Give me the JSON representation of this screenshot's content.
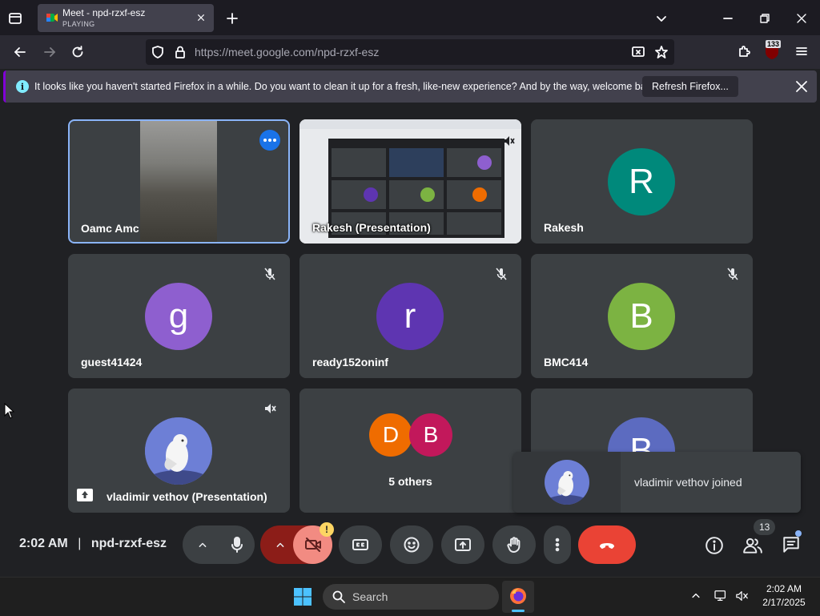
{
  "browser": {
    "tab_title": "Meet - npd-rzxf-esz",
    "tab_status": "PLAYING",
    "url_prefix": "https://meet.google.com/",
    "url_path": "npd-rzxf-esz",
    "extension_badge": "133"
  },
  "notification": {
    "message": "It looks like you haven't started Firefox in a while. Do you want to clean it up for a fresh, like-new experience? And by the way, welcome back!",
    "button_label": "Refresh Firefox..."
  },
  "tiles": [
    {
      "name": "Oamc Amc"
    },
    {
      "name": "Rakesh (Presentation)"
    },
    {
      "name": "Rakesh",
      "initial": "R",
      "color": "#00897b"
    },
    {
      "name": "guest41424",
      "initial": "g",
      "color": "#8e5fcf"
    },
    {
      "name": "ready152oninf",
      "initial": "r",
      "color": "#5e35b1"
    },
    {
      "name": "BMC414",
      "initial": "B",
      "color": "#7cb342"
    },
    {
      "name": "vladimir vethov (Presentation)"
    },
    {
      "name": "5 others",
      "initials": [
        "D",
        "B"
      ],
      "colors": [
        "#ef6c00",
        "#c2185b"
      ]
    },
    {
      "initial": "B",
      "color": "#5c6bc0"
    }
  ],
  "toast": {
    "text": "vladimir vethov joined"
  },
  "meeting": {
    "time": "2:02 AM",
    "separator": "|",
    "code": "npd-rzxf-esz",
    "participants_count": "13"
  },
  "colors": {
    "end_call": "#ea4335",
    "camera_off": "#f28b82",
    "warning": "#fdd663"
  },
  "taskbar": {
    "search_label": "Search",
    "clock_time": "2:02 AM",
    "clock_date": "2/17/2025"
  }
}
